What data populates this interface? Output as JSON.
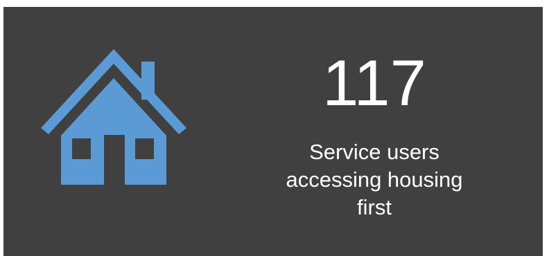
{
  "card": {
    "background": "#404040",
    "icon": "house-icon",
    "icon_color": "#5b9bd5",
    "value": "117",
    "label_lines": [
      "Service users",
      "accessing housing",
      "first"
    ]
  }
}
